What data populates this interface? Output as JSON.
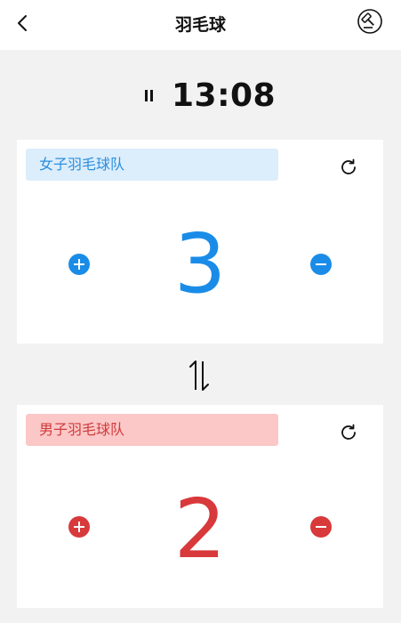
{
  "header": {
    "title": "羽毛球",
    "back_icon": "chevron-left-icon",
    "action_icon": "gavel-icon"
  },
  "timer": {
    "time": "13:08",
    "pause_icon": "pause-icon"
  },
  "teams": [
    {
      "name": "女子羽毛球队",
      "score": "3",
      "color": "#1a8ce8",
      "tag_bg": "#dcedfb"
    },
    {
      "name": "男子羽毛球队",
      "score": "2",
      "color": "#d8393b",
      "tag_bg": "#fcc7c7"
    }
  ],
  "icons": {
    "reset": "refresh-icon",
    "increment": "plus-circle-icon",
    "decrement": "minus-circle-icon",
    "swap": "swap-vertical-icon"
  }
}
